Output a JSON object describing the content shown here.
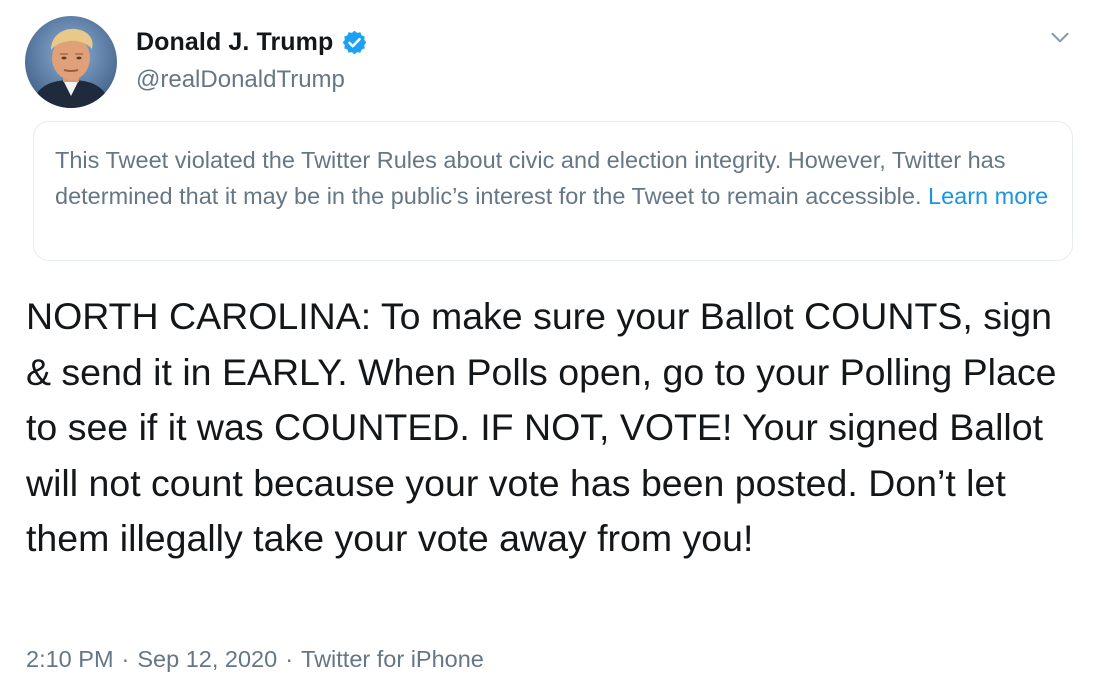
{
  "author": {
    "display_name": "Donald J. Trump",
    "handle": "@realDonaldTrump",
    "verified": true,
    "avatar_icon": "profile-photo-avatar"
  },
  "menu": {
    "icon": "chevron-down-icon"
  },
  "notice": {
    "text": "This Tweet violated the Twitter Rules about civic and election integrity. However, Twitter has determined that it may be in the public’s interest for the Tweet to remain accessible.",
    "link_label": "Learn more"
  },
  "tweet": {
    "text": "NORTH CAROLINA: To make sure your Ballot COUNTS, sign & send it in EARLY. When Polls open, go to your Polling Place to see if it was COUNTED. IF NOT, VOTE! Your signed Ballot will not count because your vote has been posted. Don’t let them illegally take your vote away from you!"
  },
  "meta": {
    "time": "2:10 PM",
    "separator": "·",
    "date": "Sep 12, 2020",
    "source": "Twitter for iPhone"
  },
  "colors": {
    "text_primary": "#14171a",
    "text_secondary": "#657786",
    "link": "#1b95e0",
    "verified_badge": "#1da1f2",
    "notice_border": "#e6ecf0"
  }
}
